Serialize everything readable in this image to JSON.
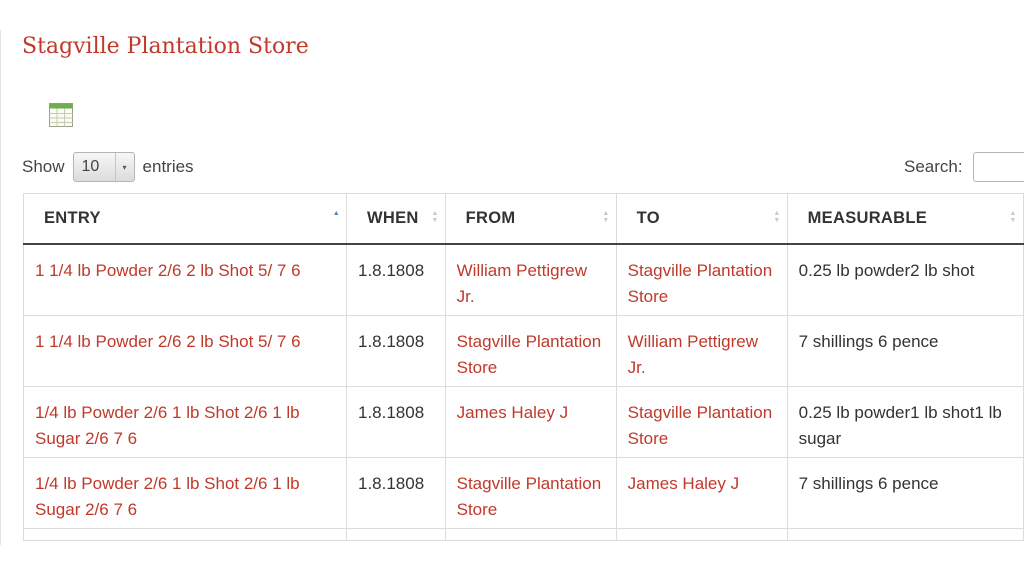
{
  "page": {
    "title": "Stagville Plantation Store"
  },
  "controls": {
    "show_label": "Show",
    "entries_label": "entries",
    "length_value": "10",
    "search_label": "Search:",
    "search_value": ""
  },
  "table": {
    "columns": [
      {
        "label": "ENTRY",
        "sort": "asc"
      },
      {
        "label": "WHEN",
        "sort": "none"
      },
      {
        "label": "FROM",
        "sort": "none"
      },
      {
        "label": "TO",
        "sort": "none"
      },
      {
        "label": "MEASURABLE",
        "sort": "none"
      }
    ],
    "rows": [
      {
        "entry": "1 1/4 lb Powder 2/6 2 lb Shot 5/ 7 6",
        "when": "1.8.1808",
        "from": "William Pettigrew Jr.",
        "to": "Stagville Plantation Store",
        "measurable": "0.25 lb powder2 lb shot"
      },
      {
        "entry": "1 1/4 lb Powder 2/6 2 lb Shot 5/ 7 6",
        "when": "1.8.1808",
        "from": "Stagville Plantation Store",
        "to": "William Pettigrew Jr.",
        "measurable": "7 shillings 6 pence"
      },
      {
        "entry": "1/4 lb Powder 2/6 1 lb Shot 2/6 1 lb Sugar 2/6 7 6",
        "when": "1.8.1808",
        "from": "James Haley J",
        "to": "Stagville Plantation Store",
        "measurable": "0.25 lb powder1 lb shot1 lb sugar"
      },
      {
        "entry": "1/4 lb Powder 2/6 1 lb Shot 2/6 1 lb Sugar 2/6 7 6",
        "when": "1.8.1808",
        "from": "Stagville Plantation Store",
        "to": "James Haley J",
        "measurable": "7 shillings 6 pence"
      }
    ]
  },
  "icons": {
    "export": "spreadsheet-icon"
  },
  "colors": {
    "link": "#c0392b",
    "sort_active": "#4a86c5",
    "header_rule": "#444444"
  }
}
